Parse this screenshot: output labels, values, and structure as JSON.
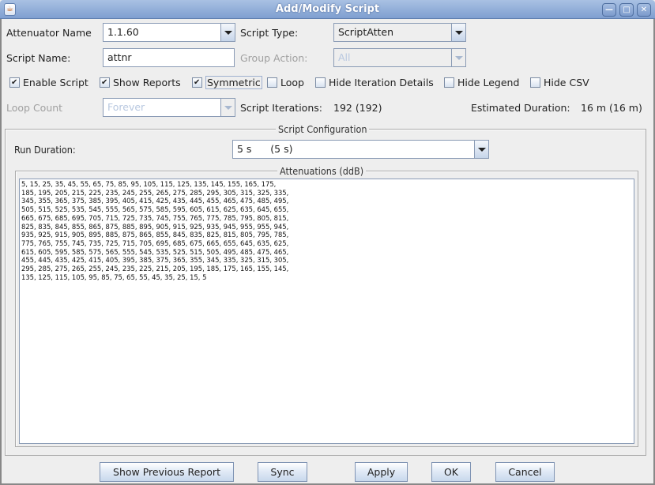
{
  "window": {
    "title": "Add/Modify Script",
    "controls": [
      "minimize",
      "maximize",
      "close"
    ]
  },
  "form": {
    "attenuator_name_label": "Attenuator Name",
    "attenuator_name_value": "1.1.60",
    "script_type_label": "Script Type:",
    "script_type_value": "ScriptAtten",
    "script_name_label": "Script Name:",
    "script_name_value": "attnr",
    "group_action_label": "Group Action:",
    "group_action_value": "All",
    "loop_count_label": "Loop Count",
    "loop_count_value": "Forever",
    "script_iterations_label": "Script Iterations:",
    "script_iterations_value": "192 (192)",
    "estimated_duration_label": "Estimated Duration:",
    "estimated_duration_value": "16 m (16 m)"
  },
  "checkboxes": [
    {
      "label": "Enable Script",
      "checked": true
    },
    {
      "label": "Show Reports",
      "checked": true
    },
    {
      "label": "Symmetric",
      "checked": true
    },
    {
      "label": "Loop",
      "checked": false
    },
    {
      "label": "Hide Iteration Details",
      "checked": false
    },
    {
      "label": "Hide Legend",
      "checked": false
    },
    {
      "label": "Hide CSV",
      "checked": false
    }
  ],
  "config": {
    "title": "Script Configuration",
    "run_duration_label": "Run Duration:",
    "run_duration_value": "5 s      (5 s)",
    "attenuations_title": "Attenuations (ddB)",
    "attenuations_text": "5, 15, 25, 35, 45, 55, 65, 75, 85, 95, 105, 115, 125, 135, 145, 155, 165, 175,\n185, 195, 205, 215, 225, 235, 245, 255, 265, 275, 285, 295, 305, 315, 325, 335,\n345, 355, 365, 375, 385, 395, 405, 415, 425, 435, 445, 455, 465, 475, 485, 495,\n505, 515, 525, 535, 545, 555, 565, 575, 585, 595, 605, 615, 625, 635, 645, 655,\n665, 675, 685, 695, 705, 715, 725, 735, 745, 755, 765, 775, 785, 795, 805, 815,\n825, 835, 845, 855, 865, 875, 885, 895, 905, 915, 925, 935, 945, 955, 955, 945,\n935, 925, 915, 905, 895, 885, 875, 865, 855, 845, 835, 825, 815, 805, 795, 785,\n775, 765, 755, 745, 735, 725, 715, 705, 695, 685, 675, 665, 655, 645, 635, 625,\n615, 605, 595, 585, 575, 565, 555, 545, 535, 525, 515, 505, 495, 485, 475, 465,\n455, 445, 435, 425, 415, 405, 395, 385, 375, 365, 355, 345, 335, 325, 315, 305,\n295, 285, 275, 265, 255, 245, 235, 225, 215, 205, 195, 185, 175, 165, 155, 145,\n135, 125, 115, 105, 95, 85, 75, 65, 55, 45, 35, 25, 15, 5"
  },
  "buttons": {
    "show_previous_report": "Show Previous Report",
    "sync": "Sync",
    "apply": "Apply",
    "ok": "OK",
    "cancel": "Cancel"
  },
  "icons": {
    "app": "java-cup-icon",
    "minimize": "minimize-icon",
    "maximize": "maximize-icon",
    "close": "close-icon"
  }
}
